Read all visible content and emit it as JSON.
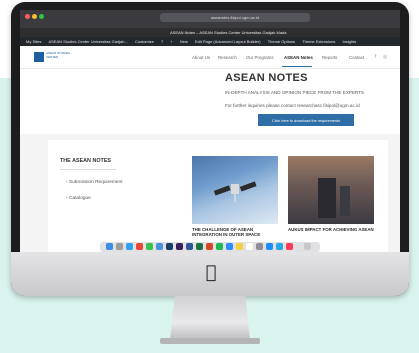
{
  "browser": {
    "url": "aseanotes.fisipol.ugm.ac.id",
    "tab_title": "ASEAN Notes – ASEAN Studies Center Universitas Gadjah Mada"
  },
  "admin_bar": {
    "items": [
      "My Sites",
      "ASEAN Studies Center Universitas Gadjah...",
      "Customize",
      "7",
      "+",
      "New",
      "Edit Page (Advanced Layout Builder)",
      "Theme Options",
      "Theme Extensions",
      "Insights"
    ]
  },
  "site": {
    "logo_text": "ASEAN STUDIES CENTER",
    "nav": [
      "About Us",
      "Research",
      "Our Programs",
      "ASEAN Notes",
      "Reports",
      "Contact"
    ]
  },
  "hero": {
    "title": "ASEAN NOTES",
    "subtitle": "IN-DEPTH ANALYSIS AND OPINION PIECE FROM THE EXPERTS",
    "contact": "For further inquiries please contact researchasc.fisipol@ugm.ac.id",
    "button": "Click here to download the requirements"
  },
  "sidebar": {
    "title": "THE ASEAN NOTES",
    "items": [
      "Submission Requirement",
      "Catalogue"
    ]
  },
  "posts": [
    {
      "title": "THE CHALLENGE OF ASEAN INTEGRATION IN OUTER SPACE"
    },
    {
      "title": "AUKUS IMPACT FOR ACHIEVING ASEAN"
    }
  ],
  "colors": {
    "accent": "#2d6ea6",
    "background": "#d9f3ee"
  }
}
